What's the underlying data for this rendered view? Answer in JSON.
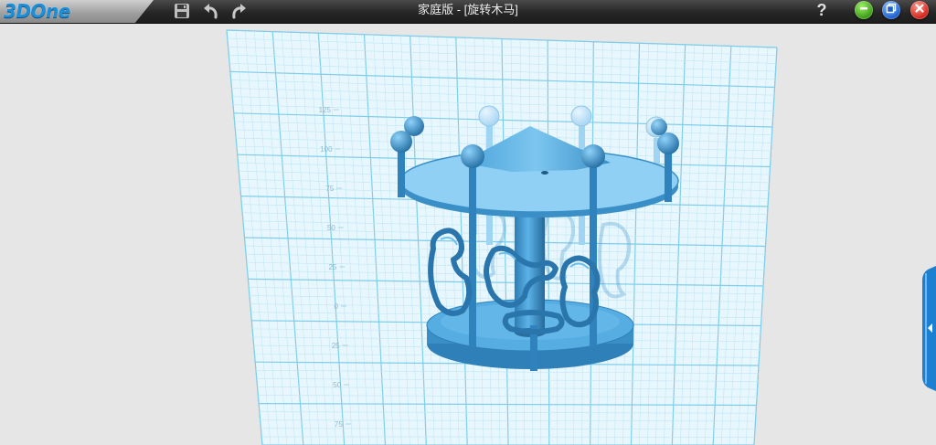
{
  "app": {
    "logo_text": "3DOne",
    "title": "家庭版 - [旋转木马]",
    "accent_color": "#1e8fd6"
  },
  "toolbar": {
    "save_icon": "save-icon",
    "undo_icon": "undo-icon",
    "redo_icon": "redo-icon"
  },
  "window_controls": {
    "help_label": "?",
    "minimize_icon": "minimize-icon",
    "maximize_icon": "maximize-icon",
    "close_icon": "close-icon"
  },
  "viewport": {
    "model_name": "旋转木马",
    "model_color": "#3a8fc6",
    "grid_color": "#7fd0ec",
    "ruler_ticks": [
      "125",
      "100",
      "75",
      "50",
      "25",
      "0",
      "25",
      "50",
      "75"
    ]
  },
  "side_panel": {
    "toggle_icon": "collapse-left-arrow-icon"
  }
}
